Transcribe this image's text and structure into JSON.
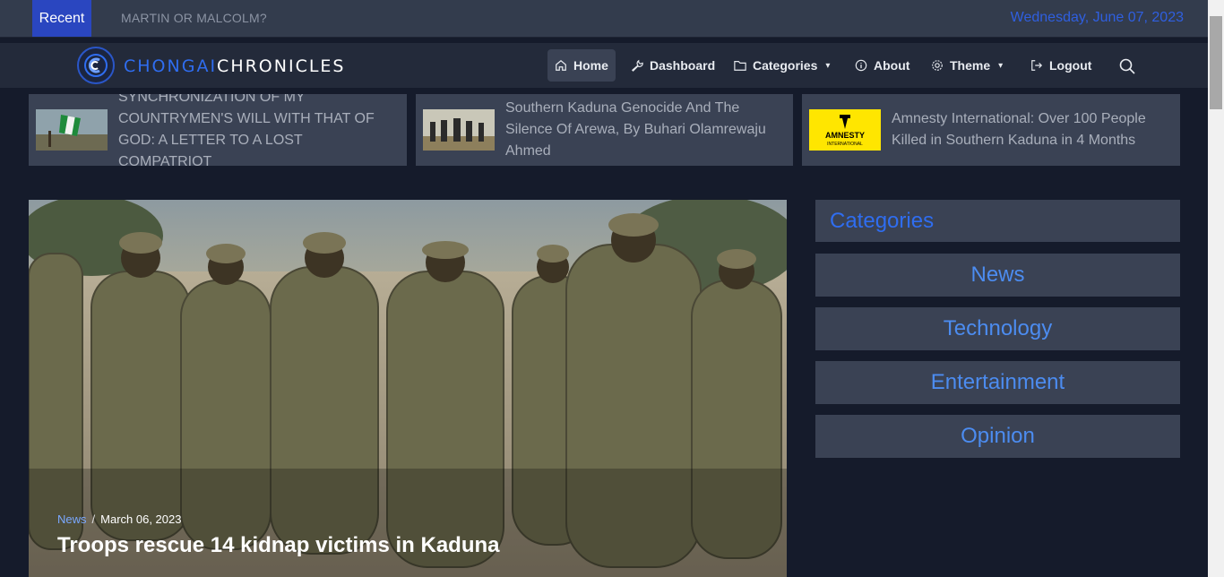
{
  "ticker": {
    "recent_label": "Recent",
    "headline": "MARTIN OR MALCOLM?",
    "date": "Wednesday, June 07, 2023"
  },
  "brand": {
    "part1": "CHONGAI",
    "part2": "CHRONICLES"
  },
  "nav": {
    "home": "Home",
    "dashboard": "Dashboard",
    "categories": "Categories",
    "about": "About",
    "theme": "Theme",
    "logout": "Logout"
  },
  "top_stories": [
    {
      "title": "SYNCHRONIZATION OF MY COUNTRYMEN'S WILL WITH THAT OF GOD: A LETTER TO A LOST COMPATRIOT"
    },
    {
      "title": "Southern Kaduna Genocide And The Silence Of Arewa, By Buhari Olamrewaju Ahmed"
    },
    {
      "title": "Amnesty International: Over 100 People Killed in Southern Kaduna in 4 Months",
      "logo_text": "AMNESTY INTERNATIONAL"
    }
  ],
  "hero": {
    "category": "News",
    "separator": "/",
    "date": "March 06, 2023",
    "title": "Troops rescue 14 kidnap victims in Kaduna"
  },
  "sidebar": {
    "heading": "Categories",
    "items": [
      "News",
      "Technology",
      "Entertainment",
      "Opinion"
    ]
  },
  "colors": {
    "accent": "#2f6df0",
    "recent_bg": "#2a46c0",
    "panel": "#3a4254",
    "page_bg": "#151b2b"
  }
}
